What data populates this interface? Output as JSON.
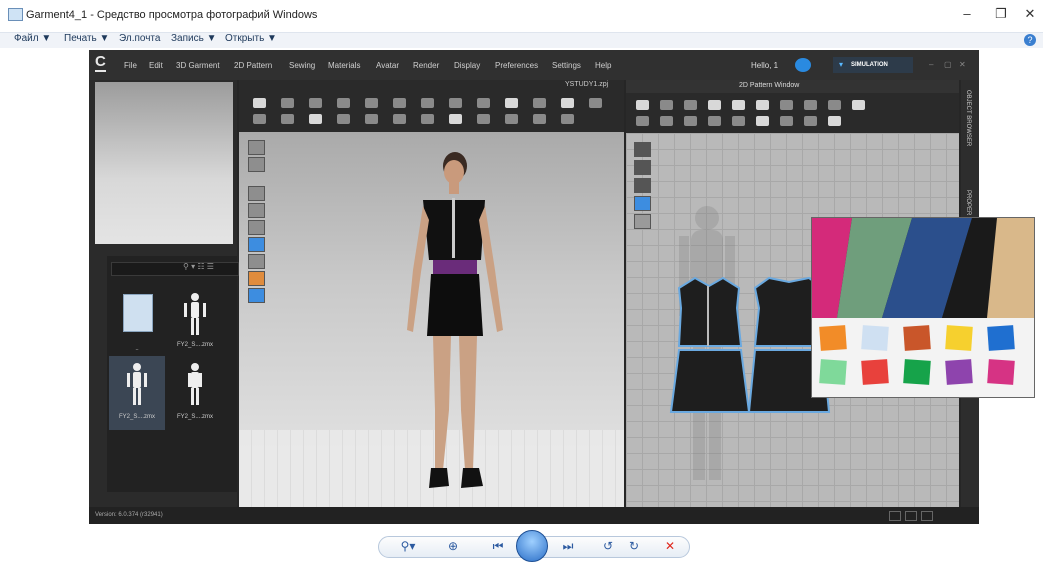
{
  "window": {
    "title": "Garment4_1 - Средство просмотра фотографий Windows",
    "minimize": "–",
    "maximize": "❐",
    "close": "✕"
  },
  "viewer_menu": {
    "items": [
      "Файл ▼",
      "Печать ▼",
      "Эл.почта",
      "Запись ▼",
      "Открыть ▼"
    ],
    "help": "?"
  },
  "clo": {
    "logo": "C",
    "menu": [
      "File",
      "Edit",
      "3D Garment",
      "2D Pattern",
      "Sewing",
      "Materials",
      "Avatar",
      "Render",
      "Display",
      "Preferences",
      "Settings",
      "Help"
    ],
    "user": "Hello, 1",
    "simulation": "SIMULATION",
    "view3d_file": "YSTUDY1.zpj",
    "pattern_title": "2D Pattern Window",
    "side_tabs": [
      "OBJECT BROWSER",
      "PROPER"
    ],
    "version": "Version: 6.0.374 (r32941)",
    "library": {
      "items": [
        {
          "label": "..",
          "icon": "folder-icon"
        },
        {
          "label": "FY2_S....zmx",
          "icon": "avatar-icon"
        },
        {
          "label": "FY2_S....zmx",
          "icon": "avatar-icon"
        },
        {
          "label": "FY2_S....zmx",
          "icon": "avatar-icon"
        }
      ]
    }
  },
  "fabric_swatches": [
    "#f28c28",
    "#cfe0f2",
    "#c9562a",
    "#f6d02e",
    "#1f6fd0",
    "#7fd99a",
    "#e8413c",
    "#16a34a",
    "#8e44ad",
    "#d63384"
  ],
  "controls": {
    "zoom": "⚲▾",
    "fit": "⊕",
    "prev": "⏮",
    "next": "⏭",
    "rotate_ccw": "↺",
    "rotate_cw": "↻",
    "delete": "✕"
  }
}
